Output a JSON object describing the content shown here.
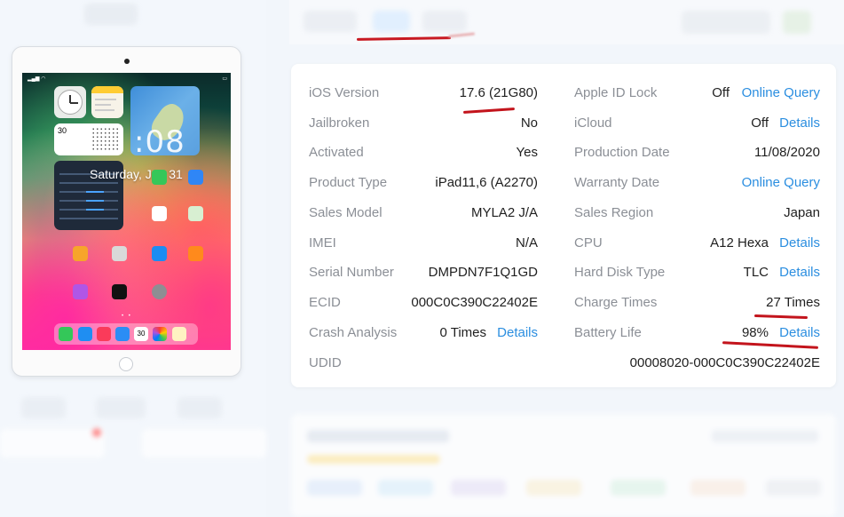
{
  "device": {
    "date_line": "Saturday, Jun 31",
    "clock_digits": "08",
    "calendar_day": "30",
    "dock_calendar": "30"
  },
  "info": {
    "left": [
      {
        "label": "iOS Version",
        "value": "17.6 (21G80)"
      },
      {
        "label": "Jailbroken",
        "value": "No"
      },
      {
        "label": "Activated",
        "value": "Yes"
      },
      {
        "label": "Product Type",
        "value": "iPad11,6 (A2270)"
      },
      {
        "label": "Sales Model",
        "value": "MYLA2 J/A"
      },
      {
        "label": "IMEI",
        "value": "N/A"
      },
      {
        "label": "Serial Number",
        "value": "DMPDN7F1Q1GD"
      },
      {
        "label": "ECID",
        "value": "000C0C390C22402E"
      },
      {
        "label": "Crash Analysis",
        "value": "0 Times",
        "link": "Details"
      },
      {
        "label": "UDID",
        "value": "00008020-000C0C390C22402E"
      }
    ],
    "right": [
      {
        "label": "Apple ID Lock",
        "value": "Off",
        "link": "Online Query"
      },
      {
        "label": "iCloud",
        "value": "Off",
        "link": "Details"
      },
      {
        "label": "Production Date",
        "value": "11/08/2020"
      },
      {
        "label": "Warranty Date",
        "link": "Online Query"
      },
      {
        "label": "Sales Region",
        "value": "Japan"
      },
      {
        "label": "CPU",
        "value": "A12 Hexa",
        "link": "Details"
      },
      {
        "label": "Hard Disk Type",
        "value": "TLC",
        "link": "Details"
      },
      {
        "label": "Charge Times",
        "value": "27 Times"
      },
      {
        "label": "Battery Life",
        "value": "98%",
        "link": "Details"
      }
    ]
  },
  "colors": {
    "label": "#8b8f96",
    "value": "#1f1f1f",
    "link": "#2b8ee0",
    "annotation": "#c3141c",
    "background": "#f2f6fb",
    "card": "#ffffff"
  }
}
